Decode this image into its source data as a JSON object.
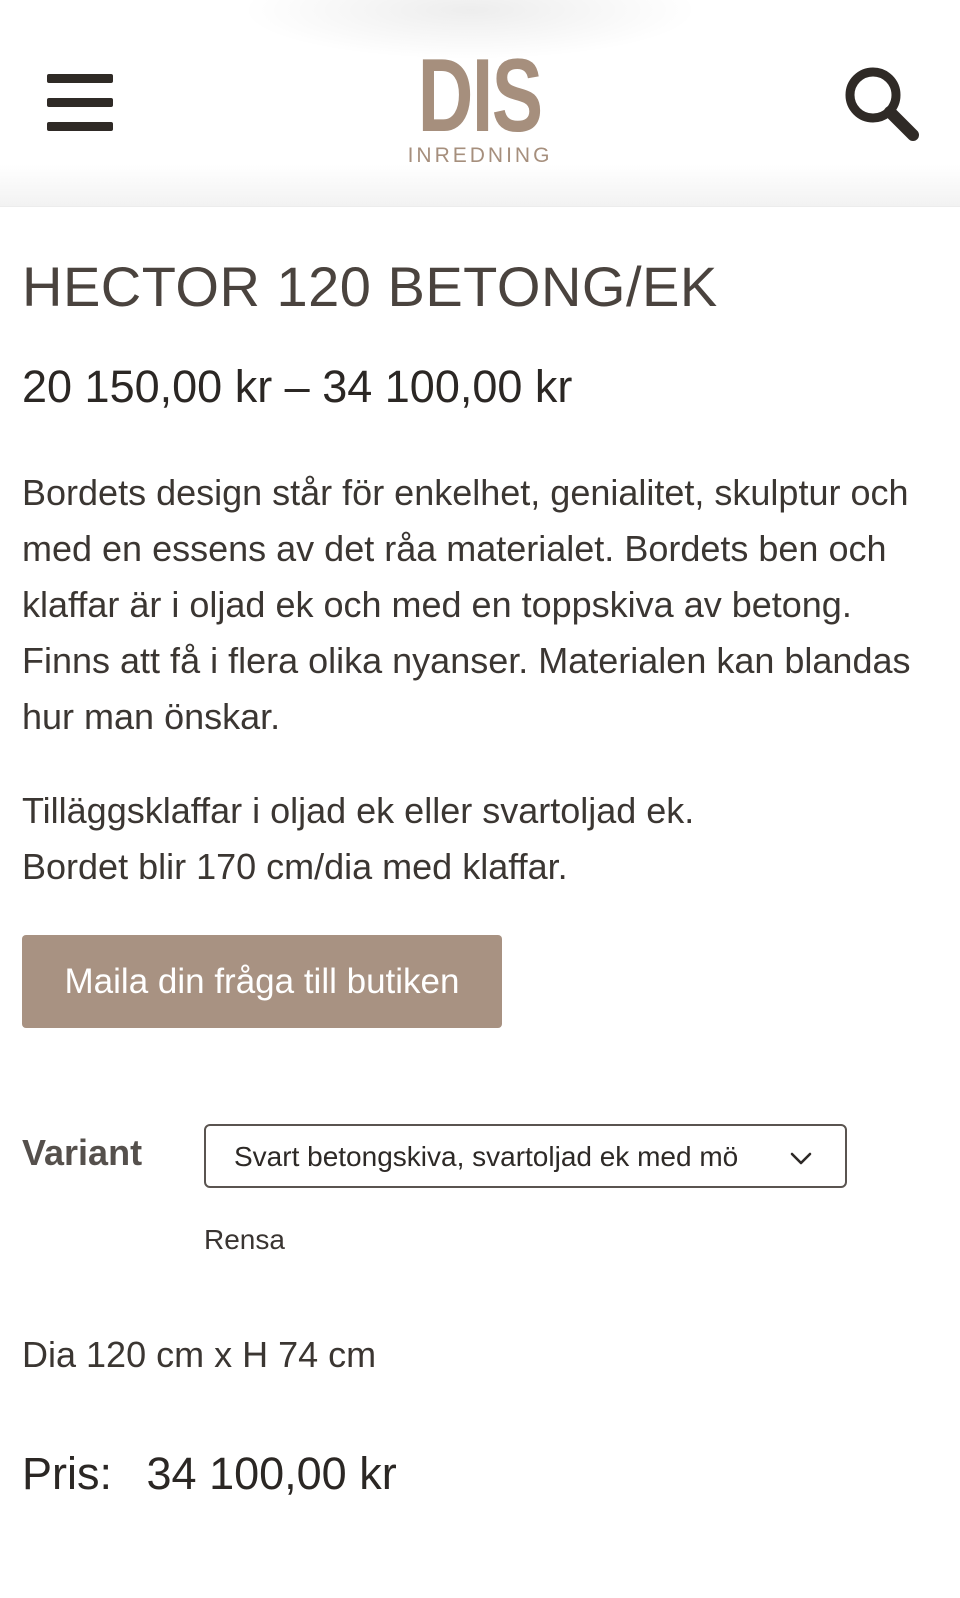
{
  "header": {
    "logo_main": "DIS",
    "logo_sub": "INREDNING",
    "menu_icon": "hamburger-menu-icon",
    "search_icon": "search-icon"
  },
  "product": {
    "title": "HECTOR 120 BETONG/EK",
    "price_range": "20 150,00 kr – 34 100,00 kr",
    "description": "Bordets design står för enkelhet, genialitet, skulptur och med en essens av det råa materialet. Bordets ben och klaffar är i oljad ek och med en toppskiva av betong. Finns att få i flera olika nyanser. Materialen kan blandas hur man önskar.",
    "extra_line1": "Tilläggsklaffar i oljad ek eller svartoljad ek.",
    "extra_line2": "Bordet blir 170 cm/dia med klaffar.",
    "mail_button": "Maila din fråga till butiken",
    "variant_label": "Variant",
    "variant_selected": "Svart betongskiva, svartoljad ek med mö",
    "clear_label": "Rensa",
    "dimensions": "Dia 120 cm x H 74 cm",
    "price_label": "Pris:",
    "price_value": "34 100,00 kr"
  },
  "colors": {
    "brand": "#a68f7d",
    "button_bg": "#a89282",
    "text_dark": "#2b2724"
  }
}
